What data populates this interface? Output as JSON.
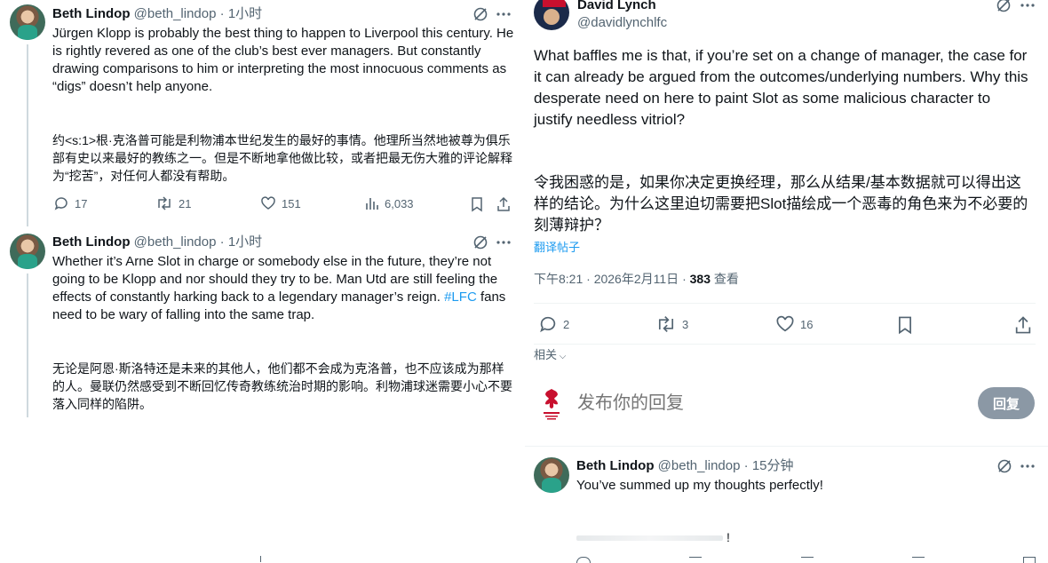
{
  "left": {
    "tweet1": {
      "name": "Beth Lindop",
      "handle": "@beth_lindop",
      "sep": "·",
      "time": "1小时",
      "text_en": "Jürgen Klopp is probably the best thing to happen to Liverpool this century. He is rightly revered as one of the club’s best ever managers. But constantly drawing comparisons to him or interpreting the most innocuous comments as “digs” doesn’t help anyone.",
      "text_zh": "约<s:1>根·克洛普可能是利物浦本世纪发生的最好的事情。他理所当然地被尊为俱乐部有史以来最好的教练之一。但是不断地拿他做比较，或者把最无伤大雅的评论解释为“挖苦”，对任何人都没有帮助。",
      "replies": "17",
      "retweets": "21",
      "likes": "151",
      "views": "6,033"
    },
    "tweet2": {
      "name": "Beth Lindop",
      "handle": "@beth_lindop",
      "sep": "·",
      "time": "1小时",
      "text_en_a": "Whether it’s Arne Slot in charge or somebody else in the future, they’re not going to be Klopp and nor should they try to be. Man Utd are still feeling the effects of constantly harking back to a legendary manager’s reign. ",
      "hashtag": "#LFC",
      "text_en_b": " fans need to be wary of falling into the same trap.",
      "text_zh": "无论是阿恩·斯洛特还是未来的其他人，他们都不会成为克洛普，也不应该成为那样的人。曼联仍然感受到不断回忆传奇教练统治时期的影响。利物浦球迷需要小心不要落入同样的陷阱。"
    }
  },
  "right": {
    "main": {
      "name": "David Lynch",
      "handle": "@davidlynchlfc",
      "text_en": "What baffles me is that, if you’re set on a change of manager, the case for it can already be argued from the outcomes/underlying numbers. Why this desperate need on here to paint Slot as some malicious character to justify needless vitriol?",
      "text_zh": "令我困惑的是，如果你决定更换经理，那么从结果/基本数据就可以得出这样的结论。为什么这里迫切需要把Slot描绘成一个恶毒的角色来为不必要的刻薄辩护？",
      "translate_link": "翻译帖子",
      "time": "下午8:21",
      "date": "2026年2月11日",
      "views": "383",
      "views_label": "查看",
      "replies": "2",
      "retweets": "3",
      "likes": "16",
      "related": "相关"
    },
    "composer": {
      "placeholder": "发布你的回复",
      "button": "回复"
    },
    "reply": {
      "name": "Beth Lindop",
      "handle": "@beth_lindop",
      "sep": "·",
      "time": "15分钟",
      "text": "You’ve summed up my thoughts perfectly!",
      "trailing": "!"
    }
  },
  "colors": {
    "link": "#1d9bf0",
    "muted": "#536471",
    "text": "#0f1419",
    "reply_button": "#8b98a5",
    "liverpool_red": "#c8102e"
  },
  "icons": {
    "grok": "grok-icon",
    "more": "more-icon",
    "reply": "reply-icon",
    "retweet": "retweet-icon",
    "like": "heart-icon",
    "views": "views-icon",
    "bookmark": "bookmark-icon",
    "share": "share-icon"
  }
}
